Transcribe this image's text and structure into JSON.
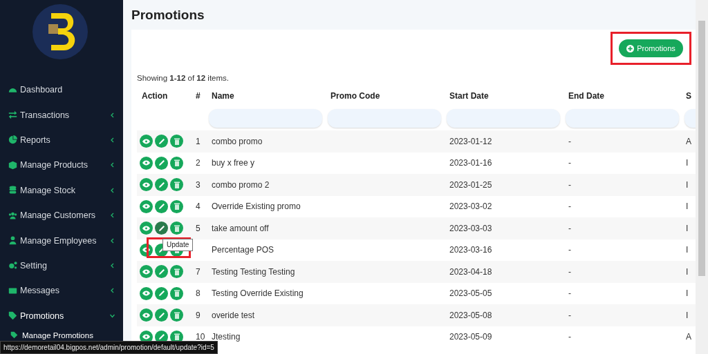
{
  "sidebar": {
    "items": [
      {
        "label": "Dashboard",
        "kind": "link",
        "expanded": false
      },
      {
        "label": "Transactions",
        "kind": "group",
        "expanded": false
      },
      {
        "label": "Reports",
        "kind": "group",
        "expanded": false
      },
      {
        "label": "Manage Products",
        "kind": "group",
        "expanded": false
      },
      {
        "label": "Manage Stock",
        "kind": "group",
        "expanded": false
      },
      {
        "label": "Manage Customers",
        "kind": "group",
        "expanded": false
      },
      {
        "label": "Manage Employees",
        "kind": "group",
        "expanded": false
      },
      {
        "label": "Setting",
        "kind": "group",
        "expanded": false
      },
      {
        "label": "Messages",
        "kind": "group",
        "expanded": false
      },
      {
        "label": "Promotions",
        "kind": "group",
        "expanded": true,
        "children": [
          {
            "label": "Manage Promotions"
          }
        ]
      }
    ]
  },
  "page_title": "Promotions",
  "add_button": {
    "label": "Promotions"
  },
  "summary": "Showing **1-12** of **12** items.",
  "table": {
    "columns": [
      "Action",
      "#",
      "Name",
      "Promo Code",
      "Start Date",
      "End Date",
      "S"
    ],
    "rows": [
      {
        "number": "1",
        "name": "combo promo",
        "start_date": "2023-01-12",
        "end_date": "-",
        "column_7": "A",
        "edit_hovered": false
      },
      {
        "number": "2",
        "name": "buy x free y",
        "start_date": "2023-01-16",
        "end_date": "-",
        "column_7": "I",
        "edit_hovered": false
      },
      {
        "number": "3",
        "name": "combo promo 2",
        "start_date": "2023-01-25",
        "end_date": "-",
        "column_7": "I",
        "edit_hovered": false
      },
      {
        "number": "4",
        "name": "Override Existing promo",
        "start_date": "2023-03-02",
        "end_date": "-",
        "column_7": "I",
        "edit_hovered": false
      },
      {
        "number": "5",
        "name": "take amount off",
        "start_date": "2023-03-03",
        "end_date": "-",
        "column_7": "I",
        "edit_hovered": true
      },
      {
        "name": "Percentage POS",
        "start_date": "2023-03-16",
        "end_date": "-",
        "column_7": "I",
        "edit_hovered": false,
        "tooltip": "Update"
      },
      {
        "number": "7",
        "name": "Testing Testing Testing",
        "start_date": "2023-04-18",
        "end_date": "-",
        "column_7": "I",
        "edit_hovered": false
      },
      {
        "number": "8",
        "name": "Testing Override Existing",
        "start_date": "2023-05-05",
        "end_date": "-",
        "column_7": "I",
        "edit_hovered": false
      },
      {
        "number": "9",
        "name": "overide test",
        "start_date": "2023-05-08",
        "end_date": "-",
        "column_7": "I",
        "edit_hovered": false
      },
      {
        "number": "10",
        "name": "Jtesting",
        "start_date": "2023-05-09",
        "end_date": "-",
        "column_7": "A",
        "edit_hovered": false
      }
    ]
  },
  "status_url": "https://demoretail04.bigpos.net/admin/promotion/default/update?id=5"
}
